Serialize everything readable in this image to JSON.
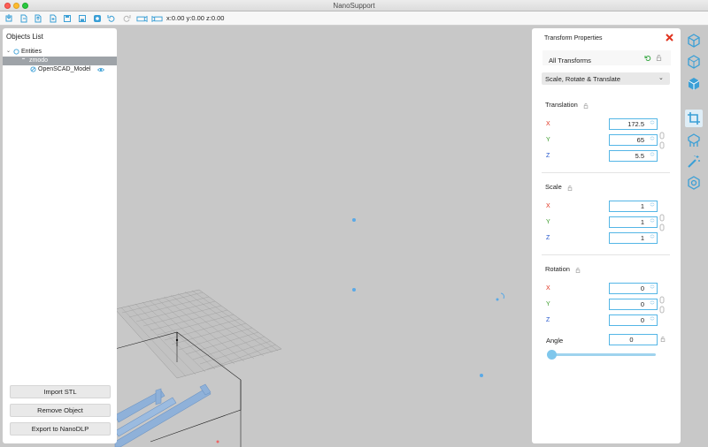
{
  "window": {
    "title": "NanoSupport"
  },
  "toolbar": {
    "buttons": [
      {
        "name": "import-icon"
      },
      {
        "name": "open-file-icon"
      },
      {
        "name": "export-file-icon"
      },
      {
        "name": "add-file-icon"
      },
      {
        "name": "save-icon"
      },
      {
        "name": "save-as-icon"
      },
      {
        "name": "settings-icon"
      },
      {
        "name": "undo-icon"
      },
      {
        "name": "redo-icon"
      },
      {
        "name": "camera-front-icon"
      },
      {
        "name": "camera-side-icon"
      }
    ],
    "coords": "x:0.00 y:0.00 z:0.00"
  },
  "objects": {
    "title": "Objects List",
    "tree": [
      {
        "label": "Entities",
        "level": 0,
        "selected": false,
        "visible_icon": false
      },
      {
        "label": "zmodo",
        "level": 1,
        "selected": true,
        "visible_icon": false
      },
      {
        "label": "OpenSCAD_Model",
        "level": 2,
        "selected": false,
        "visible_icon": true
      }
    ],
    "buttons": {
      "import": "Import STL",
      "remove": "Remove Object",
      "export": "Export to NanoDLP"
    }
  },
  "transform": {
    "title": "Transform Properties",
    "all_transforms": "All Transforms",
    "mode": "Scale, Rotate & Translate",
    "translation": {
      "label": "Translation",
      "x": "172.5",
      "y": "65",
      "z": "5.5"
    },
    "scale": {
      "label": "Scale",
      "x": "1",
      "y": "1",
      "z": "1"
    },
    "rotation": {
      "label": "Rotation",
      "x": "0",
      "y": "0",
      "z": "0"
    },
    "angle": {
      "label": "Angle",
      "value": "0",
      "slider_fraction": 0
    },
    "axis_labels": {
      "x": "X",
      "y": "Y",
      "z": "Z"
    }
  },
  "tools": [
    {
      "name": "cube-view-icon",
      "active": false
    },
    {
      "name": "cube-outline-icon",
      "active": false
    },
    {
      "name": "cube-solid-icon",
      "active": false
    },
    {
      "name": "crop-transform-icon",
      "active": true
    },
    {
      "name": "support-icon",
      "active": false
    },
    {
      "name": "magic-wand-icon",
      "active": false
    },
    {
      "name": "gear-cube-icon",
      "active": false
    }
  ],
  "colors": {
    "accent": "#54b6e6",
    "close": "#e0331f",
    "model": "#8fb1d9"
  }
}
